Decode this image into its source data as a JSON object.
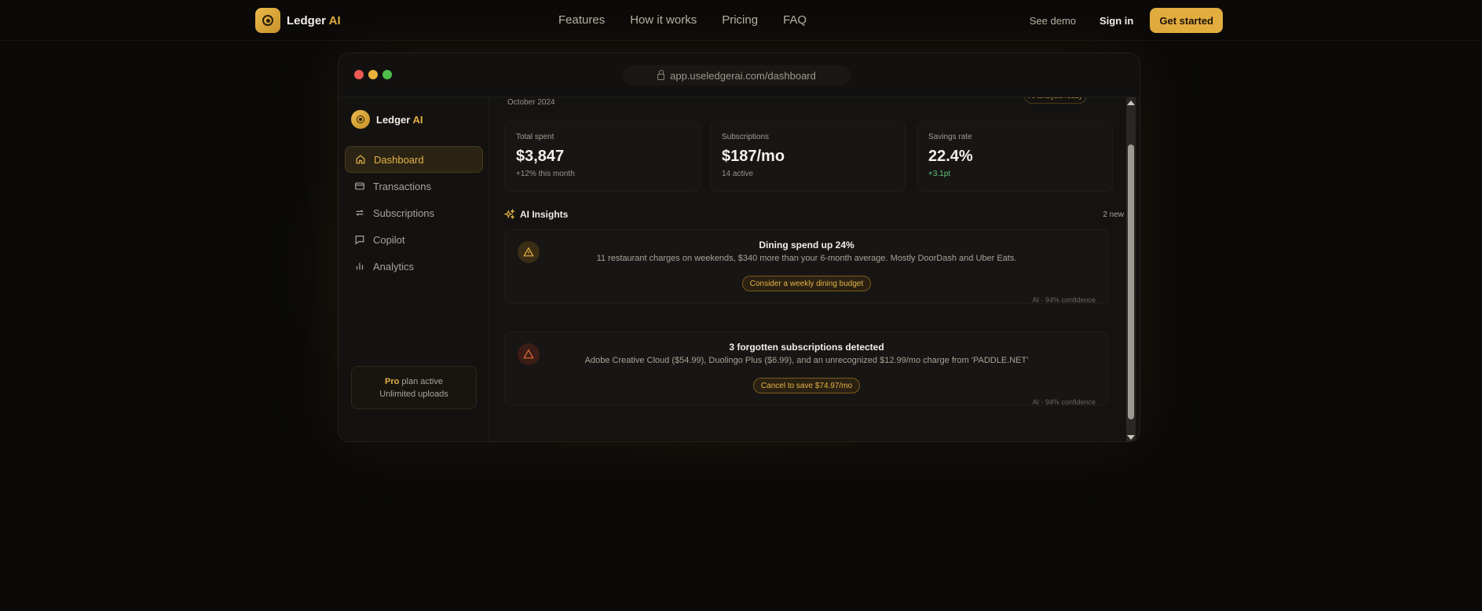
{
  "nav": {
    "brand_prefix": "Ledger",
    "brand_accent": "AI",
    "links": [
      "Features",
      "How it works",
      "Pricing",
      "FAQ"
    ],
    "see_demo": "See demo",
    "sign_in": "Sign in",
    "get_started": "Get started"
  },
  "window": {
    "url": "app.useledgerai.com/dashboard"
  },
  "sidebar": {
    "brand_prefix": "Ledger",
    "brand_accent": "AI",
    "items": [
      {
        "label": "Dashboard",
        "icon": "home-icon",
        "active": true
      },
      {
        "label": "Transactions",
        "icon": "credit-card-icon",
        "active": false
      },
      {
        "label": "Subscriptions",
        "icon": "repeat-icon",
        "active": false
      },
      {
        "label": "Copilot",
        "icon": "chat-icon",
        "active": false
      },
      {
        "label": "Analytics",
        "icon": "bar-chart-icon",
        "active": false
      }
    ],
    "plan_name": "Pro",
    "plan_status": "plan active",
    "plan_detail": "Unlimited uploads"
  },
  "main": {
    "date": "October 2024",
    "ai_pill": "AI analysis ready",
    "stats": [
      {
        "label": "Total spent",
        "value": "$3,847",
        "sub": "+12% this month"
      },
      {
        "label": "Subscriptions",
        "value": "$187/mo",
        "sub": "14 active"
      },
      {
        "label": "Savings rate",
        "value": "22.4%",
        "sub": "+3.1pt"
      }
    ],
    "insights_title": "AI Insights",
    "insights_count": "2 new",
    "insights": [
      {
        "title": "Dining spend up 24%",
        "text": "11 restaurant charges on weekends, $340 more than your 6-month average. Mostly DoorDash and Uber Eats.",
        "action": "Consider a weekly dining budget",
        "confidence": "AI · 94% confidence"
      },
      {
        "title": "3 forgotten subscriptions detected",
        "text": "Adobe Creative Cloud ($54.99), Duolingo Plus ($6.99), and an unrecognized $12.99/mo charge from 'PADDLE.NET'",
        "action": "Cancel to save $74.97/mo",
        "confidence": "AI · 94% confidence"
      }
    ]
  },
  "colors": {
    "accent": "#e2ad3f",
    "background": "#0b0a09",
    "positive": "#5fc77a"
  }
}
